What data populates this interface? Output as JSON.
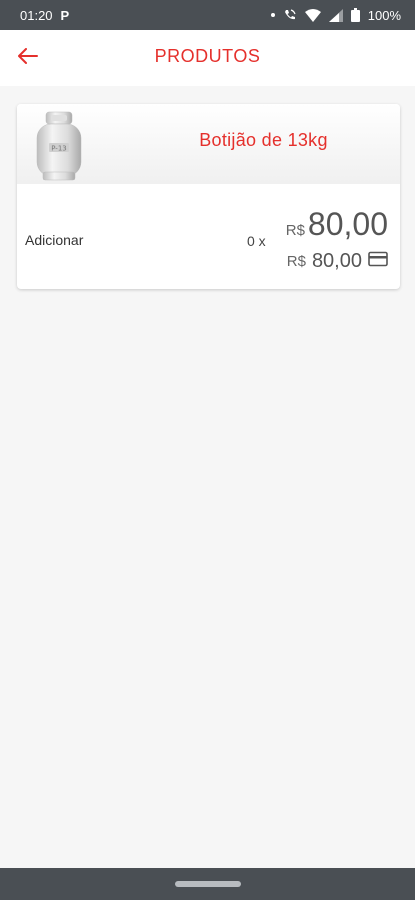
{
  "status_bar": {
    "time": "01:20",
    "app_indicator": "P",
    "battery_text": "100%",
    "icons": [
      "dot-icon",
      "wifi-call-icon",
      "wifi-icon",
      "signal-icon",
      "battery-icon"
    ]
  },
  "app_bar": {
    "title": "PRODUTOS",
    "back_icon": "arrow-left-icon"
  },
  "product": {
    "name": "Botijão de 13kg",
    "image_icon": "gas-cylinder-icon",
    "add_label": "Adicionar",
    "quantity": "0 x",
    "currency": "R$",
    "price": "80,00",
    "card_currency": "R$",
    "card_price": "80,00",
    "card_icon": "credit-card-icon"
  },
  "colors": {
    "accent": "#e5302c",
    "system_bar": "#4a4f54",
    "background": "#f6f6f6"
  }
}
